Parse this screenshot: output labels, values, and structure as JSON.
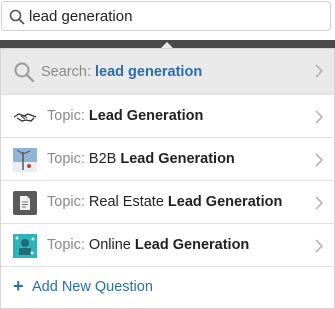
{
  "search": {
    "value": "lead generation"
  },
  "dropdown": {
    "search_row": {
      "prefix": "Search:",
      "query": "lead generation"
    },
    "topics": [
      {
        "prefix": "Topic:",
        "plain": "",
        "bold": "Lead Generation",
        "icon": "handshake-icon"
      },
      {
        "prefix": "Topic:",
        "plain": "B2B",
        "bold": "Lead Generation",
        "icon": "b2b-topic-photo-icon"
      },
      {
        "prefix": "Topic:",
        "plain": "Real Estate",
        "bold": "Lead Generation",
        "icon": "document-icon"
      },
      {
        "prefix": "Topic:",
        "plain": "Online",
        "bold": "Lead Generation",
        "icon": "online-topic-photo-icon"
      }
    ],
    "add_question": {
      "plus": "+",
      "label": "Add New Question"
    }
  },
  "colors": {
    "accent": "#2b6dad",
    "search_row_bg": "#e9e9e9",
    "strip": "#4a4a4a"
  }
}
